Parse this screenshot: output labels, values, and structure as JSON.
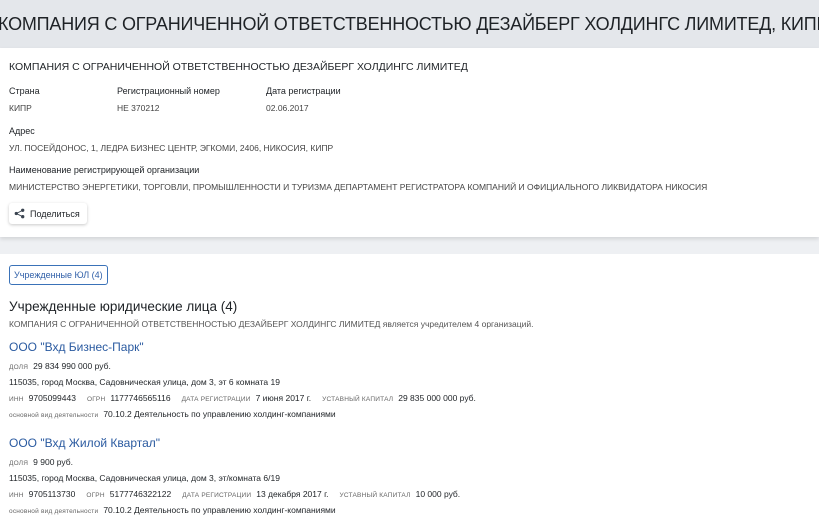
{
  "header": {
    "title": "КОМПАНИЯ С ОГРАНИЧЕННОЙ ОТВЕТСТВЕННОСТЬЮ ДЕЗАЙБЕРГ ХОЛДИНГС ЛИМИТЕД, КИПР"
  },
  "company": {
    "name": "КОМПАНИЯ С ОГРАНИЧЕННОЙ ОТВЕТСТВЕННОСТЬЮ ДЕЗАЙБЕРГ ХОЛДИНГС ЛИМИТЕД",
    "country_label": "Страна",
    "country": "КИПР",
    "reg_number_label": "Регистрационный номер",
    "reg_number": "НЕ 370212",
    "reg_date_label": "Дата регистрации",
    "reg_date": "02.06.2017",
    "address_label": "Адрес",
    "address": "УЛ. ПОСЕЙДОНОС, 1, ЛЕДРА БИЗНЕС ЦЕНТР, ЭГКОМИ, 2406, НИКОСИЯ, КИПР",
    "registrar_label": "Наименование регистрирующей организации",
    "registrar": "МИНИСТЕРСТВО ЭНЕРГЕТИКИ, ТОРГОВЛИ, ПРОМЫШЛЕННОСТИ И ТУРИЗМА ДЕПАРТАМЕНТ РЕГИСТРАТОРА КОМПАНИЙ И ОФИЦИАЛЬНОГО ЛИКВИДАТОРА НИКОСИЯ",
    "share_label": "Поделиться",
    "share_icon": "share-icon"
  },
  "tabs": {
    "founded": "Учрежденные ЮЛ (4)"
  },
  "section": {
    "title": "Учрежденные юридические лица (4)",
    "subtitle": "КОМПАНИЯ С ОГРАНИЧЕННОЙ ОТВЕТСТВЕННОСТЬЮ ДЕЗАЙБЕРГ ХОЛДИНГС ЛИМИТЕД является учредителем 4 организаций."
  },
  "orgs": [
    {
      "name": "ООО \"Вхд Бизнес-Парк\"",
      "share_label": "доля",
      "share": "29 834 990 000 руб.",
      "address": "115035, город Москва, Садовническая улица, дом 3, эт 6 комната 19",
      "inn_label": "ИНН",
      "inn": "9705099443",
      "ogrn_label": "ОГРН",
      "ogrn": "1177746565116",
      "date_label": "ДАТА РЕГИСТРАЦИИ",
      "date": "7 июня 2017 г.",
      "capital_label": "УСТАВНЫЙ КАПИТАЛ",
      "capital": "29 835 000 000 руб.",
      "activity_label": "основной вид деятельности",
      "activity": "70.10.2 Деятельность по управлению холдинг-компаниями"
    },
    {
      "name": "ООО \"Вхд Жилой Квартал\"",
      "share_label": "доля",
      "share": "9 900 руб.",
      "address": "115035, город Москва, Садовническая улица, дом 3, эт/комната 6/19",
      "inn_label": "ИНН",
      "inn": "9705113730",
      "ogrn_label": "ОГРН",
      "ogrn": "5177746322122",
      "date_label": "ДАТА РЕГИСТРАЦИИ",
      "date": "13 декабря 2017 г.",
      "capital_label": "УСТАВНЫЙ КАПИТАЛ",
      "capital": "10 000 руб.",
      "activity_label": "основной вид деятельности",
      "activity": "70.10.2 Деятельность по управлению холдинг-компаниями"
    }
  ],
  "colors": {
    "link": "#2a5aa0",
    "tab_border": "#3a72b8",
    "header_bg": "#e4e7eb"
  }
}
